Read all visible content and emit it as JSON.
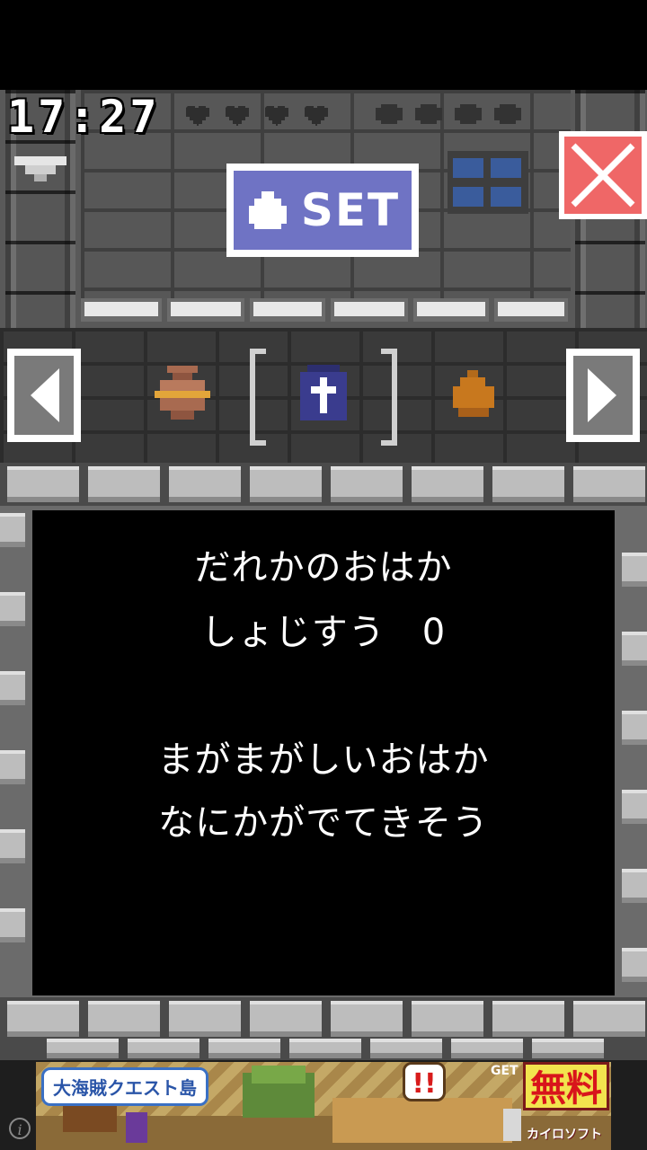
{
  "status": {
    "clock": "17:27"
  },
  "hearts": {
    "filled": 4,
    "empty": 4
  },
  "toolbar": {
    "set_label": "SET"
  },
  "selector": {
    "items": [
      "urn-icon",
      "tombstone-icon",
      "pouch-icon"
    ],
    "selected_index": 1
  },
  "message": {
    "line1": "だれかのおはか",
    "line2": "しょじすう　0",
    "line3": "まがまがしいおはか",
    "line4": "なにかがでてきそう"
  },
  "ad": {
    "title": "大海賊クエスト島",
    "free_label": "無料",
    "brand": "カイロソフト",
    "get_label": "GET",
    "bubble": "!!"
  },
  "colors": {
    "set_button": "#6f73c4",
    "close_button": "#ef6767",
    "window_pane": "#3a5c9c"
  }
}
